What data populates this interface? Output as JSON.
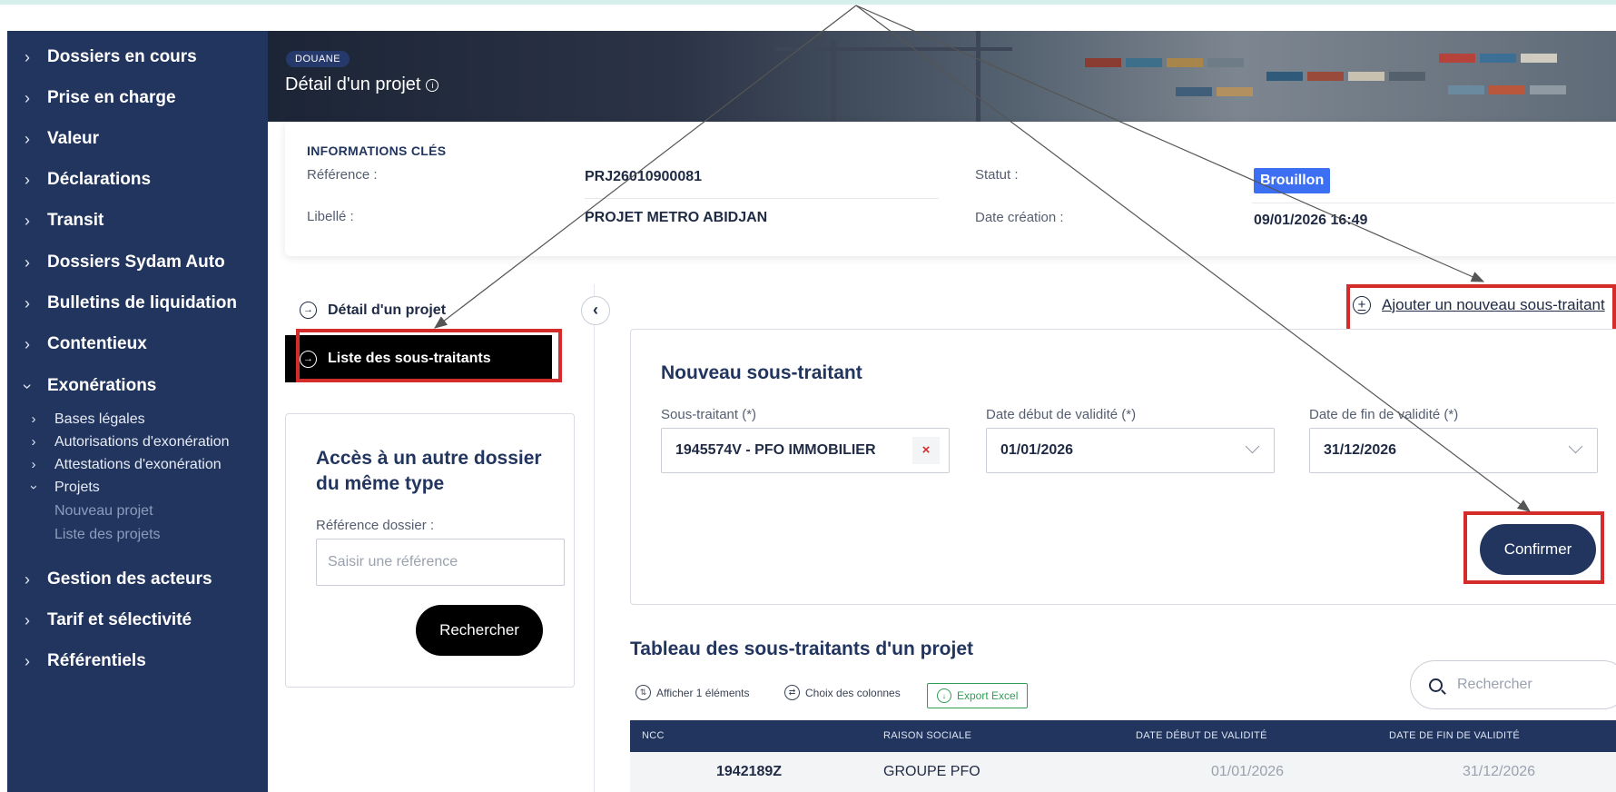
{
  "sidebar": {
    "items": [
      {
        "label": "Dossiers en cours"
      },
      {
        "label": "Prise en charge"
      },
      {
        "label": "Valeur"
      },
      {
        "label": "Déclarations"
      },
      {
        "label": "Transit"
      },
      {
        "label": "Dossiers Sydam Auto"
      },
      {
        "label": "Bulletins de liquidation"
      },
      {
        "label": "Contentieux"
      },
      {
        "label": "Exonérations"
      }
    ],
    "exonerations_sub": [
      {
        "label": "Bases légales"
      },
      {
        "label": "Autorisations d'exonération"
      },
      {
        "label": "Attestations d'exonération"
      },
      {
        "label": "Projets"
      }
    ],
    "projets_sub": [
      {
        "label": "Nouveau projet"
      },
      {
        "label": "Liste des projets"
      }
    ],
    "bottom_items": [
      {
        "label": "Gestion des acteurs"
      },
      {
        "label": "Tarif et sélectivité"
      },
      {
        "label": "Référentiels"
      }
    ]
  },
  "header": {
    "badge": "DOUANE",
    "title": "Détail d'un projet",
    "info_icon": "info-circle-icon"
  },
  "key_info": {
    "heading": "INFORMATIONS CLÉS",
    "reference_label": "Référence :",
    "reference_value": "PRJ26010900081",
    "libelle_label": "Libellé :",
    "libelle_value": "PROJET METRO ABIDJAN",
    "statut_label": "Statut :",
    "statut_value": "Brouillon",
    "date_label": "Date création :",
    "date_value": "09/01/2026 16:49",
    "status_color": "#3d6ff3"
  },
  "left_nav": {
    "detail_label": "Détail d'un projet",
    "list_label": "Liste des sous-traitants"
  },
  "other_dossier": {
    "title": "Accès à un autre dossier du même type",
    "ref_label": "Référence dossier :",
    "ref_placeholder": "Saisir une référence",
    "search_button": "Rechercher"
  },
  "add_link": "Ajouter un nouveau sous-traitant",
  "form": {
    "title": "Nouveau sous-traitant",
    "subcontractor_label": "Sous-traitant (*)",
    "subcontractor_value": "1945574V - PFO IMMOBILIER",
    "start_label": "Date début de validité (*)",
    "start_value": "01/01/2026",
    "end_label": "Date de fin de validité (*)",
    "end_value": "31/12/2026",
    "confirm_button": "Confirmer"
  },
  "table": {
    "title": "Tableau des sous-traitants d'un projet",
    "toolbar": {
      "show_label": "Afficher 1 éléments",
      "columns_label": "Choix des colonnes",
      "export_label": "Export Excel"
    },
    "search_placeholder": "Rechercher",
    "headers": [
      "NCC",
      "RAISON SOCIALE",
      "DATE DÉBUT DE VALIDITÉ",
      "DATE DE FIN DE VALIDITÉ"
    ],
    "rows": [
      [
        "1942189Z",
        "GROUPE PFO",
        "01/01/2026",
        "31/12/2026"
      ]
    ]
  },
  "colors": {
    "sidebar_bg": "#22355f",
    "highlight_red": "#d42b2b",
    "export_green": "#2f9e55"
  }
}
